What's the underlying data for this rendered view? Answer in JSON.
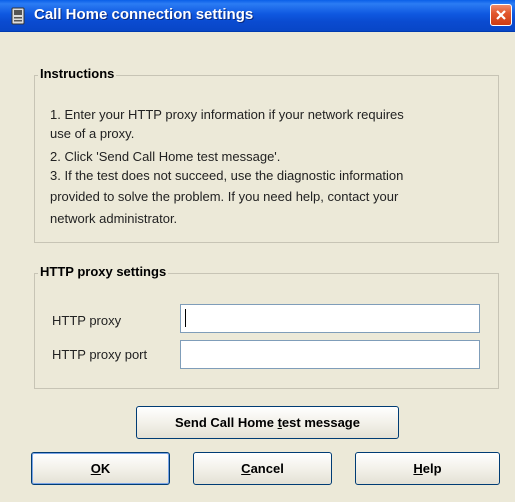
{
  "window": {
    "title": "Call Home connection settings"
  },
  "instructions": {
    "title": "Instructions",
    "lines": [
      "1. Enter your HTTP proxy information if your network requires",
      "use of a proxy.",
      "2. Click 'Send Call Home test message'.",
      "3. If the test does not succeed, use the diagnostic information",
      "provided to solve the problem.  If you need help, contact your",
      "network administrator."
    ]
  },
  "proxy": {
    "title": "HTTP proxy settings",
    "proxy_label": "HTTP proxy",
    "proxy_value": "",
    "port_label": "HTTP proxy port",
    "port_value": ""
  },
  "buttons": {
    "test_pre": "Send Call Home ",
    "test_mn": "t",
    "test_post": "est message",
    "ok_mn": "O",
    "ok_post": "K",
    "cancel_mn": "C",
    "cancel_post": "ancel",
    "help_mn": "H",
    "help_post": "elp"
  },
  "icons": {
    "title": "app-icon",
    "close": "close-icon"
  }
}
